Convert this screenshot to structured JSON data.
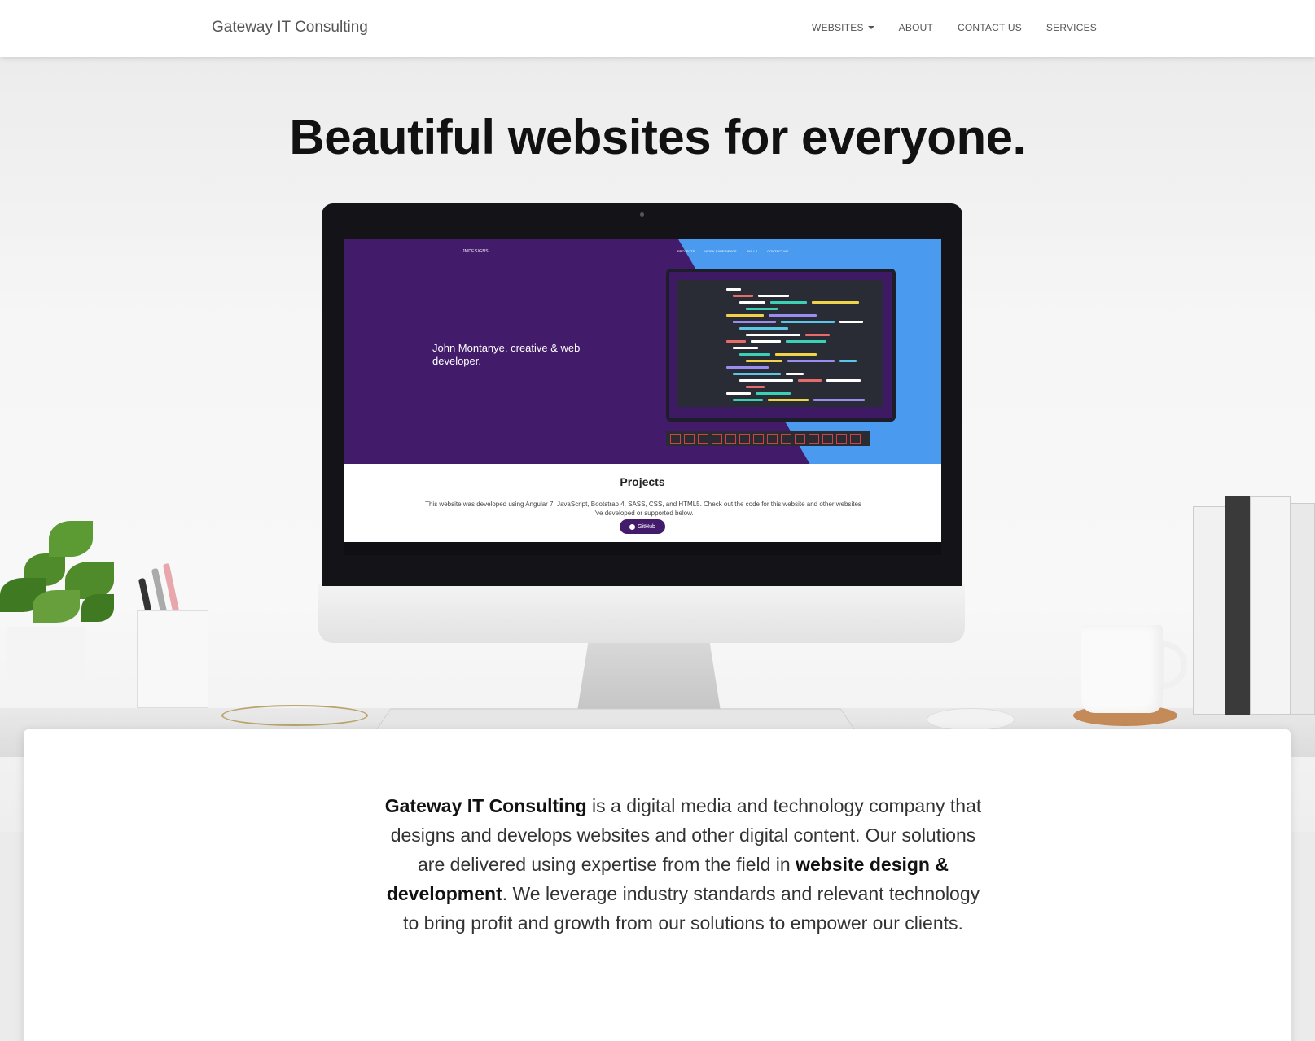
{
  "navbar": {
    "brand": "Gateway IT Consulting",
    "items": [
      {
        "label": "WEBSITES",
        "has_dropdown": true
      },
      {
        "label": "ABOUT"
      },
      {
        "label": "CONTACT US"
      },
      {
        "label": "SERVICES"
      }
    ]
  },
  "hero": {
    "title": "Beautiful websites for everyone."
  },
  "screen_preview": {
    "logo": "JMDESIGNS",
    "nav": [
      "PROJECTS",
      "WORK EXPERIENCE",
      "SKILLS",
      "CONTACT ME"
    ],
    "tagline": "John Montanye, creative & web developer.",
    "projects_heading": "Projects",
    "projects_desc": "This website was developed using Angular 7, JavaScript, Bootstrap 4, SASS, CSS, and HTML5. Check out the code for this website and other websites I've developed or supported below.",
    "github_button": "GitHub",
    "colors": {
      "purple": "#431b6b",
      "blue": "#4a9bef"
    }
  },
  "about": {
    "company": "Gateway IT Consulting",
    "text1": " is a digital media and technology company that designs and develops websites and other digital content. Our solutions are delivered using expertise from the field in ",
    "highlight": "website design & development",
    "text2": ". We leverage industry standards and relevant technology to bring profit and growth from our solutions to empower our clients."
  }
}
